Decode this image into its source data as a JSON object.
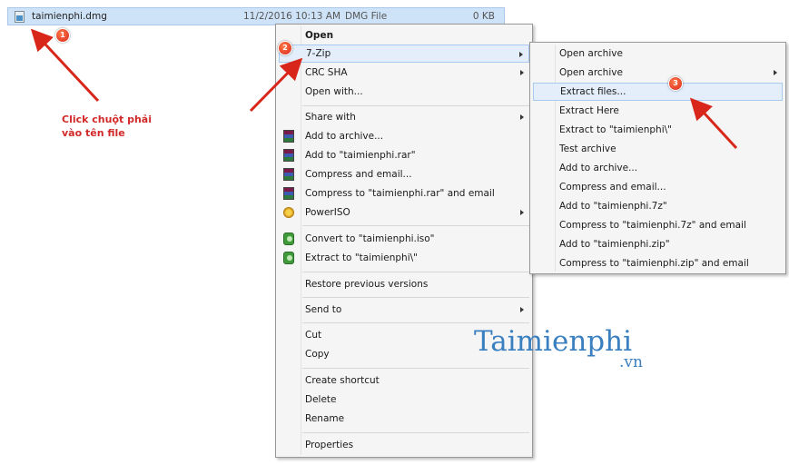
{
  "file": {
    "name": "taimienphi.dmg",
    "date": "11/2/2016 10:13 AM",
    "type": "DMG File",
    "size": "0 KB"
  },
  "annotation": {
    "text": "Click chuột phải vào tên file",
    "markers": [
      "1",
      "2",
      "3"
    ]
  },
  "context_menu": {
    "items": {
      "open": "Open",
      "seven_zip": "7-Zip",
      "crc_sha": "CRC SHA",
      "open_with": "Open with...",
      "share_with": "Share with",
      "add_to_archive": "Add to archive...",
      "add_to_rar": "Add to \"taimienphi.rar\"",
      "compress_email": "Compress and email...",
      "compress_rar_email": "Compress to \"taimienphi.rar\" and email",
      "poweriso": "PowerISO",
      "convert_iso": "Convert to \"taimienphi.iso\"",
      "extract_to_folder": "Extract to \"taimienphi\\\"",
      "restore_versions": "Restore previous versions",
      "send_to": "Send to",
      "cut": "Cut",
      "copy": "Copy",
      "create_shortcut": "Create shortcut",
      "delete": "Delete",
      "rename": "Rename",
      "properties": "Properties"
    }
  },
  "submenu_7zip": {
    "items": {
      "open_archive_1": "Open archive",
      "open_archive_2": "Open archive",
      "extract_files": "Extract files...",
      "extract_here": "Extract Here",
      "extract_to": "Extract to \"taimienphi\\\"",
      "test_archive": "Test archive",
      "add_to_archive": "Add to archive...",
      "compress_email": "Compress and email...",
      "add_to_7z": "Add to \"taimienphi.7z\"",
      "compress_7z_email": "Compress to \"taimienphi.7z\" and email",
      "add_to_zip": "Add to \"taimienphi.zip\"",
      "compress_zip_email": "Compress to \"taimienphi.zip\" and email"
    }
  },
  "watermark": {
    "brand": "Taimienphi",
    "suffix": ".vn"
  },
  "colors": {
    "selection": "#cfe3f8",
    "highlight": "#e3eefa",
    "annotation": "#d22a2a",
    "watermark": "#3a7fbf"
  }
}
